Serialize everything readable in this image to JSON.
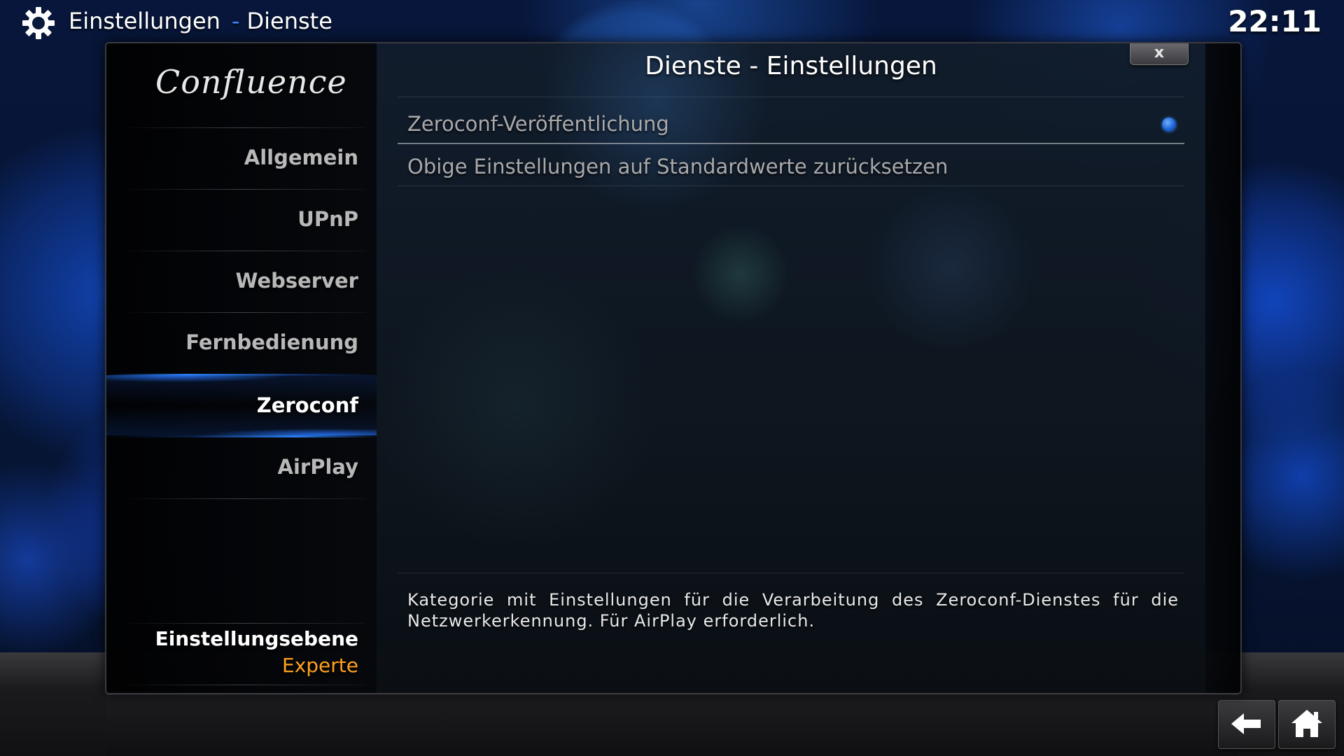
{
  "header": {
    "icon": "gear-icon",
    "title": "Einstellungen",
    "separator": "-",
    "subtitle": "Dienste",
    "clock": "22:11"
  },
  "dialog": {
    "logo_text": "Confluence",
    "title": "Dienste - Einstellungen",
    "close_label": "x"
  },
  "sidebar": {
    "items": [
      {
        "label": "Allgemein"
      },
      {
        "label": "UPnP"
      },
      {
        "label": "Webserver"
      },
      {
        "label": "Fernbedienung"
      },
      {
        "label": "Zeroconf",
        "active": true
      },
      {
        "label": "AirPlay"
      }
    ],
    "level_label": "Einstellungsebene",
    "level_value": "Experte"
  },
  "settings": [
    {
      "label": "Zeroconf-Veröffentlichung",
      "type": "radio",
      "value": true
    },
    {
      "label": "Obige Einstellungen auf Standardwerte zurücksetzen",
      "type": "action"
    }
  ],
  "description": "Kategorie mit Einstellungen für die Verarbeitung des Zeroconf-Dienstes für die Netzwerkerkennung. Für AirPlay erforderlich.",
  "footer": {
    "back_icon": "back-arrow-icon",
    "home_icon": "home-icon"
  },
  "colors": {
    "accent": "#2a7ef0",
    "level_value": "#ffa11e",
    "text": "#ffffff",
    "muted_text": "#a9a9ab"
  }
}
